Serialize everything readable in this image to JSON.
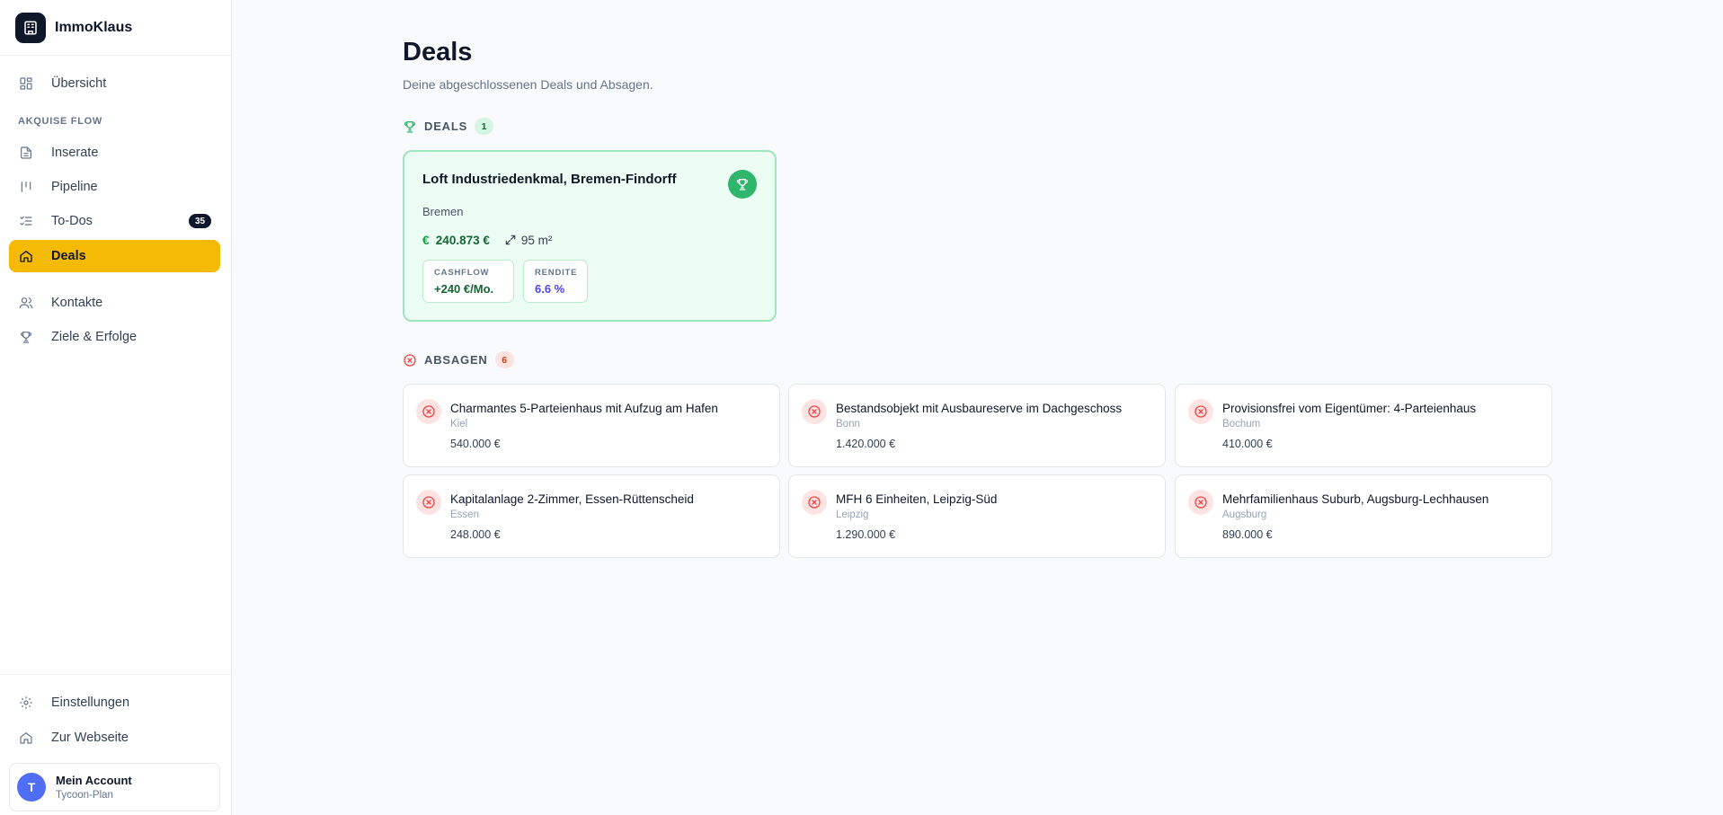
{
  "app": {
    "name": "ImmoKlaus"
  },
  "sidebar": {
    "overview_label": "Übersicht",
    "section_label": "AKQUISE FLOW",
    "items": [
      {
        "label": "Inserate"
      },
      {
        "label": "Pipeline"
      },
      {
        "label": "To-Dos",
        "badge": "35"
      },
      {
        "label": "Deals",
        "active": true
      }
    ],
    "secondary_items": [
      {
        "label": "Kontakte"
      },
      {
        "label": "Ziele & Erfolge"
      }
    ],
    "bottom_items": [
      {
        "label": "Einstellungen"
      },
      {
        "label": "Zur Webseite"
      }
    ],
    "account": {
      "initial": "T",
      "name": "Mein Account",
      "plan": "Tycoon-Plan"
    }
  },
  "header": {
    "title": "Deals",
    "subtitle": "Deine abgeschlossenen Deals und Absagen."
  },
  "deals_section": {
    "title": "DEALS",
    "count": "1",
    "deals": [
      {
        "title": "Loft Industriedenkmal, Bremen-Findorff",
        "city": "Bremen",
        "currency_symbol": "€",
        "price": "240.873 €",
        "area": "95 m²",
        "cashflow_label": "CASHFLOW",
        "cashflow_value": "+240 €/Mo.",
        "rendite_label": "RENDITE",
        "rendite_value": "6.6 %"
      }
    ]
  },
  "rejections_section": {
    "title": "ABSAGEN",
    "count": "6",
    "items": [
      {
        "title": "Charmantes 5-Parteienhaus mit Aufzug am Hafen",
        "city": "Kiel",
        "price": "540.000 €"
      },
      {
        "title": "Bestandsobjekt mit Ausbaureserve im Dachgeschoss",
        "city": "Bonn",
        "price": "1.420.000 €"
      },
      {
        "title": "Provisionsfrei vom Eigentümer: 4-Parteienhaus",
        "city": "Bochum",
        "price": "410.000 €"
      },
      {
        "title": "Kapitalanlage 2-Zimmer, Essen-Rüttenscheid",
        "city": "Essen",
        "price": "248.000 €"
      },
      {
        "title": "MFH 6 Einheiten, Leipzig-Süd",
        "city": "Leipzig",
        "price": "1.290.000 €"
      },
      {
        "title": "Mehrfamilienhaus Suburb, Augsburg-Lechhausen",
        "city": "Augsburg",
        "price": "890.000 €"
      }
    ]
  },
  "colors": {
    "accent": "#f5bb04",
    "success": "#2fb56c",
    "danger": "#ef4444",
    "brand_dark": "#0f172a"
  }
}
